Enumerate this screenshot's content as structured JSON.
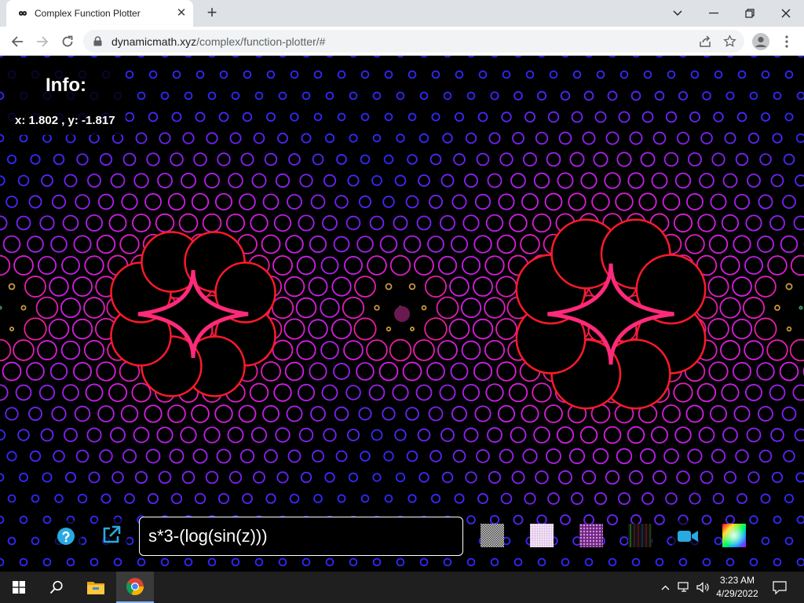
{
  "browser": {
    "tab_title": "Complex Function Plotter",
    "tab_close": "✕",
    "new_tab": "+",
    "url_host": "dynamicmath.xyz",
    "url_path": "/complex/function-plotter/#"
  },
  "info": {
    "title": "Info:",
    "coords": "x: 1.802 , y: -1.817"
  },
  "controls": {
    "function_value": "s*3-(log(sin(z)))"
  },
  "taskbar": {
    "time": "3:23 AM",
    "date": "4/29/2022"
  },
  "colors": {
    "accent_blue": "#29a9e1",
    "ring_red": "#ff1a1a",
    "ring_magenta": "#e020e0",
    "ring_blue": "#3a2cff"
  }
}
